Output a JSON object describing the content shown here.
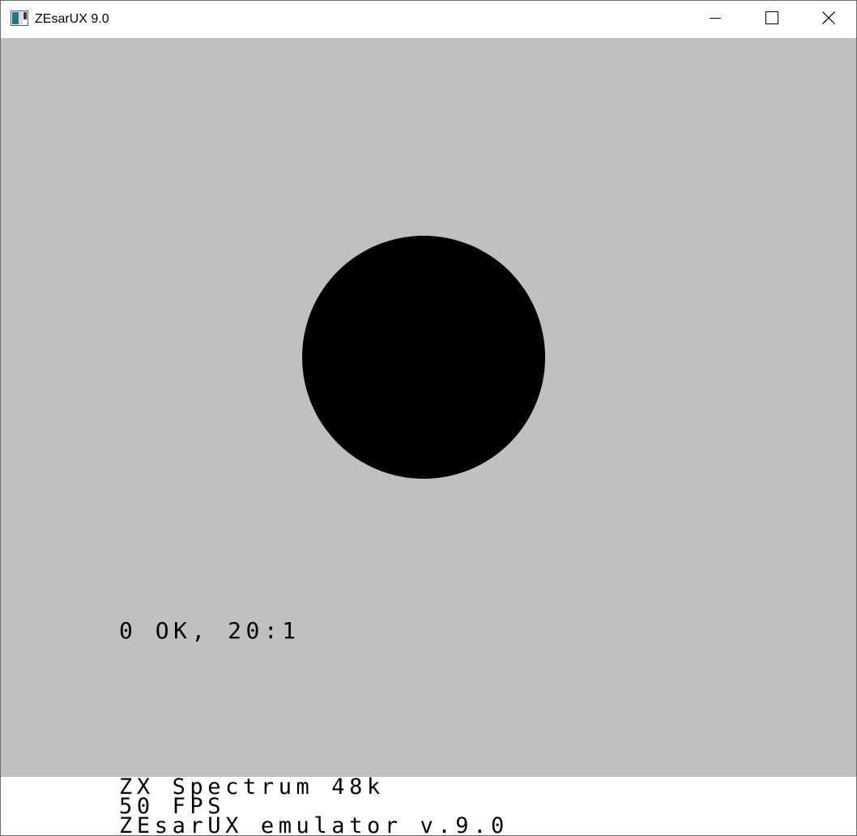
{
  "window": {
    "title": "ZEsarUX 9.0"
  },
  "icons": {
    "app": "zesarux-app-icon",
    "minimize": "minimize-icon",
    "maximize": "maximize-icon",
    "close": "close-icon"
  },
  "screen": {
    "paper_color": "#c0c0c0",
    "ink_color": "#000000",
    "shape": "filled-circle",
    "message": "0 OK, 20:1"
  },
  "footer": {
    "machine": "ZX Spectrum 48k",
    "fps": "50 FPS",
    "emulator": "ZEsarUX emulator v.9.0"
  }
}
